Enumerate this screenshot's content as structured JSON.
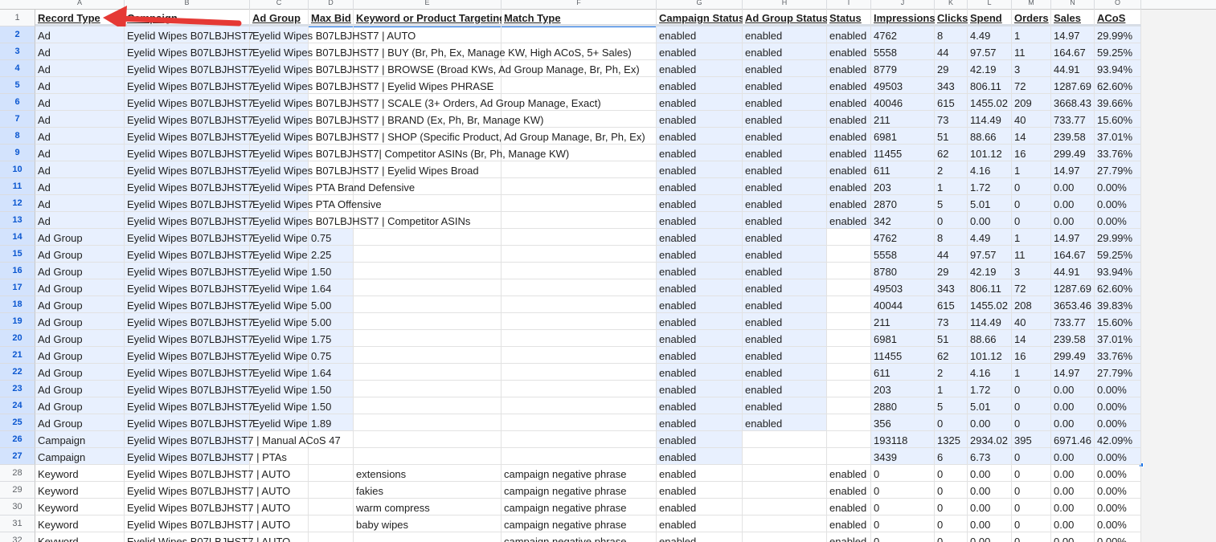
{
  "columns": [
    {
      "letter": "A",
      "header": "Record Type"
    },
    {
      "letter": "B",
      "header": "Campaign"
    },
    {
      "letter": "C",
      "header": "Ad Group"
    },
    {
      "letter": "D",
      "header": "Max Bid"
    },
    {
      "letter": "E",
      "header": "Keyword or Product Targeting"
    },
    {
      "letter": "F",
      "header": "Match Type"
    },
    {
      "letter": "G",
      "header": "Campaign Status"
    },
    {
      "letter": "H",
      "header": "Ad Group Status"
    },
    {
      "letter": "I",
      "header": "Status"
    },
    {
      "letter": "J",
      "header": "Impressions"
    },
    {
      "letter": "K",
      "header": "Clicks"
    },
    {
      "letter": "L",
      "header": "Spend"
    },
    {
      "letter": "M",
      "header": "Orders"
    },
    {
      "letter": "N",
      "header": "Sales"
    },
    {
      "letter": "O",
      "header": "ACoS"
    }
  ],
  "header_row_number": "1",
  "rows": [
    {
      "num": "2",
      "cells": [
        "Ad",
        "Eyelid Wipes B07LBJHST7",
        "Eyelid Wipes B07LBJHST7 | AUTO",
        "",
        "",
        "",
        "enabled",
        "enabled",
        "enabled",
        "4762",
        "8",
        "4.49",
        "1",
        "14.97",
        "29.99%"
      ]
    },
    {
      "num": "3",
      "cells": [
        "Ad",
        "Eyelid Wipes B07LBJHST7",
        "Eyelid Wipes B07LBJHST7 | BUY (Br, Ph, Ex, Manage KW, High ACoS, 5+ Sales)",
        "",
        "",
        "",
        "enabled",
        "enabled",
        "enabled",
        "5558",
        "44",
        "97.57",
        "11",
        "164.67",
        "59.25%"
      ]
    },
    {
      "num": "4",
      "cells": [
        "Ad",
        "Eyelid Wipes B07LBJHST7",
        "Eyelid Wipes B07LBJHST7 | BROWSE (Broad KWs, Ad Group Manage, Br, Ph, Ex)",
        "",
        "",
        "",
        "enabled",
        "enabled",
        "enabled",
        "8779",
        "29",
        "42.19",
        "3",
        "44.91",
        "93.94%"
      ]
    },
    {
      "num": "5",
      "cells": [
        "Ad",
        "Eyelid Wipes B07LBJHST7",
        "Eyelid Wipes B07LBJHST7 | Eyelid Wipes PHRASE",
        "",
        "",
        "",
        "enabled",
        "enabled",
        "enabled",
        "49503",
        "343",
        "806.11",
        "72",
        "1287.69",
        "62.60%"
      ]
    },
    {
      "num": "6",
      "cells": [
        "Ad",
        "Eyelid Wipes B07LBJHST7",
        "Eyelid Wipes B07LBJHST7 | SCALE (3+ Orders, Ad Group Manage, Exact)",
        "",
        "",
        "",
        "enabled",
        "enabled",
        "enabled",
        "40046",
        "615",
        "1455.02",
        "209",
        "3668.43",
        "39.66%"
      ]
    },
    {
      "num": "7",
      "cells": [
        "Ad",
        "Eyelid Wipes B07LBJHST7",
        "Eyelid Wipes B07LBJHST7 | BRAND (Ex, Ph, Br, Manage KW)",
        "",
        "",
        "",
        "enabled",
        "enabled",
        "enabled",
        "211",
        "73",
        "114.49",
        "40",
        "733.77",
        "15.60%"
      ]
    },
    {
      "num": "8",
      "cells": [
        "Ad",
        "Eyelid Wipes B07LBJHST7",
        "Eyelid Wipes B07LBJHST7 | SHOP (Specific Product, Ad Group Manage, Br, Ph, Ex)",
        "",
        "",
        "",
        "enabled",
        "enabled",
        "enabled",
        "6981",
        "51",
        "88.66",
        "14",
        "239.58",
        "37.01%"
      ]
    },
    {
      "num": "9",
      "cells": [
        "Ad",
        "Eyelid Wipes B07LBJHST7",
        "Eyelid Wipes B07LBJHST7| Competitor ASINs (Br, Ph, Manage KW)",
        "",
        "",
        "",
        "enabled",
        "enabled",
        "enabled",
        "11455",
        "62",
        "101.12",
        "16",
        "299.49",
        "33.76%"
      ]
    },
    {
      "num": "10",
      "cells": [
        "Ad",
        "Eyelid Wipes B07LBJHST7",
        "Eyelid Wipes B07LBJHST7 | Eyelid Wipes Broad",
        "",
        "",
        "",
        "enabled",
        "enabled",
        "enabled",
        "611",
        "2",
        "4.16",
        "1",
        "14.97",
        "27.79%"
      ]
    },
    {
      "num": "11",
      "cells": [
        "Ad",
        "Eyelid Wipes B07LBJHST7",
        "Eyelid Wipes PTA Brand Defensive",
        "",
        "",
        "",
        "enabled",
        "enabled",
        "enabled",
        "203",
        "1",
        "1.72",
        "0",
        "0.00",
        "0.00%"
      ]
    },
    {
      "num": "12",
      "cells": [
        "Ad",
        "Eyelid Wipes B07LBJHST7",
        "Eyelid Wipes PTA Offensive",
        "",
        "",
        "",
        "enabled",
        "enabled",
        "enabled",
        "2870",
        "5",
        "5.01",
        "0",
        "0.00",
        "0.00%"
      ]
    },
    {
      "num": "13",
      "cells": [
        "Ad",
        "Eyelid Wipes B07LBJHST7",
        "Eyelid Wipes B07LBJHST7 | Competitor ASINs",
        "",
        "",
        "",
        "enabled",
        "enabled",
        "enabled",
        "342",
        "0",
        "0.00",
        "0",
        "0.00",
        "0.00%"
      ]
    },
    {
      "num": "14",
      "cells": [
        "Ad Group",
        "Eyelid Wipes B07LBJHST7",
        "Eyelid Wipe",
        "0.75",
        "",
        "",
        "enabled",
        "enabled",
        "",
        "4762",
        "8",
        "4.49",
        "1",
        "14.97",
        "29.99%"
      ]
    },
    {
      "num": "15",
      "cells": [
        "Ad Group",
        "Eyelid Wipes B07LBJHST7",
        "Eyelid Wipe",
        "2.25",
        "",
        "",
        "enabled",
        "enabled",
        "",
        "5558",
        "44",
        "97.57",
        "11",
        "164.67",
        "59.25%"
      ]
    },
    {
      "num": "16",
      "cells": [
        "Ad Group",
        "Eyelid Wipes B07LBJHST7",
        "Eyelid Wipe",
        "1.50",
        "",
        "",
        "enabled",
        "enabled",
        "",
        "8780",
        "29",
        "42.19",
        "3",
        "44.91",
        "93.94%"
      ]
    },
    {
      "num": "17",
      "cells": [
        "Ad Group",
        "Eyelid Wipes B07LBJHST7",
        "Eyelid Wipe",
        "1.64",
        "",
        "",
        "enabled",
        "enabled",
        "",
        "49503",
        "343",
        "806.11",
        "72",
        "1287.69",
        "62.60%"
      ]
    },
    {
      "num": "18",
      "cells": [
        "Ad Group",
        "Eyelid Wipes B07LBJHST7",
        "Eyelid Wipe",
        "5.00",
        "",
        "",
        "enabled",
        "enabled",
        "",
        "40044",
        "615",
        "1455.02",
        "208",
        "3653.46",
        "39.83%"
      ]
    },
    {
      "num": "19",
      "cells": [
        "Ad Group",
        "Eyelid Wipes B07LBJHST7",
        "Eyelid Wipe",
        "5.00",
        "",
        "",
        "enabled",
        "enabled",
        "",
        "211",
        "73",
        "114.49",
        "40",
        "733.77",
        "15.60%"
      ]
    },
    {
      "num": "20",
      "cells": [
        "Ad Group",
        "Eyelid Wipes B07LBJHST7",
        "Eyelid Wipe",
        "1.75",
        "",
        "",
        "enabled",
        "enabled",
        "",
        "6981",
        "51",
        "88.66",
        "14",
        "239.58",
        "37.01%"
      ]
    },
    {
      "num": "21",
      "cells": [
        "Ad Group",
        "Eyelid Wipes B07LBJHST7",
        "Eyelid Wipe",
        "0.75",
        "",
        "",
        "enabled",
        "enabled",
        "",
        "11455",
        "62",
        "101.12",
        "16",
        "299.49",
        "33.76%"
      ]
    },
    {
      "num": "22",
      "cells": [
        "Ad Group",
        "Eyelid Wipes B07LBJHST7",
        "Eyelid Wipe",
        "1.64",
        "",
        "",
        "enabled",
        "enabled",
        "",
        "611",
        "2",
        "4.16",
        "1",
        "14.97",
        "27.79%"
      ]
    },
    {
      "num": "23",
      "cells": [
        "Ad Group",
        "Eyelid Wipes B07LBJHST7",
        "Eyelid Wipe",
        "1.50",
        "",
        "",
        "enabled",
        "enabled",
        "",
        "203",
        "1",
        "1.72",
        "0",
        "0.00",
        "0.00%"
      ]
    },
    {
      "num": "24",
      "cells": [
        "Ad Group",
        "Eyelid Wipes B07LBJHST7",
        "Eyelid Wipe",
        "1.50",
        "",
        "",
        "enabled",
        "enabled",
        "",
        "2880",
        "5",
        "5.01",
        "0",
        "0.00",
        "0.00%"
      ]
    },
    {
      "num": "25",
      "cells": [
        "Ad Group",
        "Eyelid Wipes B07LBJHST7",
        "Eyelid Wipe",
        "1.89",
        "",
        "",
        "enabled",
        "enabled",
        "",
        "356",
        "0",
        "0.00",
        "0",
        "0.00",
        "0.00%"
      ]
    },
    {
      "num": "26",
      "cells": [
        "Campaign",
        "Eyelid Wipes B07LBJHST7 | Manual ACoS 47",
        "",
        "",
        "",
        "",
        "enabled",
        "",
        "",
        "193118",
        "1325",
        "2934.02",
        "395",
        "6971.46",
        "42.09%"
      ]
    },
    {
      "num": "27",
      "cells": [
        "Campaign",
        "Eyelid Wipes B07LBJHST7 | PTAs",
        "",
        "",
        "",
        "",
        "enabled",
        "",
        "",
        "3439",
        "6",
        "6.73",
        "0",
        "0.00",
        "0.00%"
      ]
    },
    {
      "num": "28",
      "cells": [
        "Keyword",
        "Eyelid Wipes B07LBJHST7 | AUTO",
        "",
        "",
        "extensions",
        "campaign negative phrase",
        "enabled",
        "",
        "enabled",
        "0",
        "0",
        "0.00",
        "0",
        "0.00",
        "0.00%"
      ]
    },
    {
      "num": "29",
      "cells": [
        "Keyword",
        "Eyelid Wipes B07LBJHST7 | AUTO",
        "",
        "",
        "fakies",
        "campaign negative phrase",
        "enabled",
        "",
        "enabled",
        "0",
        "0",
        "0.00",
        "0",
        "0.00",
        "0.00%"
      ]
    },
    {
      "num": "30",
      "cells": [
        "Keyword",
        "Eyelid Wipes B07LBJHST7 | AUTO",
        "",
        "",
        "warm compress",
        "campaign negative phrase",
        "enabled",
        "",
        "enabled",
        "0",
        "0",
        "0.00",
        "0",
        "0.00",
        "0.00%"
      ]
    },
    {
      "num": "31",
      "cells": [
        "Keyword",
        "Eyelid Wipes B07LBJHST7 | AUTO",
        "",
        "",
        "baby wipes",
        "campaign negative phrase",
        "enabled",
        "",
        "enabled",
        "0",
        "0",
        "0.00",
        "0",
        "0.00",
        "0.00%"
      ]
    },
    {
      "num": "32",
      "cells": [
        "Keyword",
        "Eyelid Wipes B07LBJHST7 | AUTO",
        "",
        "",
        "",
        "campaign negative phrase",
        "enabled",
        "",
        "enabled",
        "0",
        "0",
        "0.00",
        "0",
        "0.00",
        "0.00%"
      ]
    }
  ],
  "selection": {
    "first_row": "2",
    "last_row": "27",
    "active_cell": "A2"
  },
  "colors": {
    "selection_fill": "#e8f0fe",
    "selection_border": "#1a73e8",
    "annotation_arrow": "#e53935"
  }
}
